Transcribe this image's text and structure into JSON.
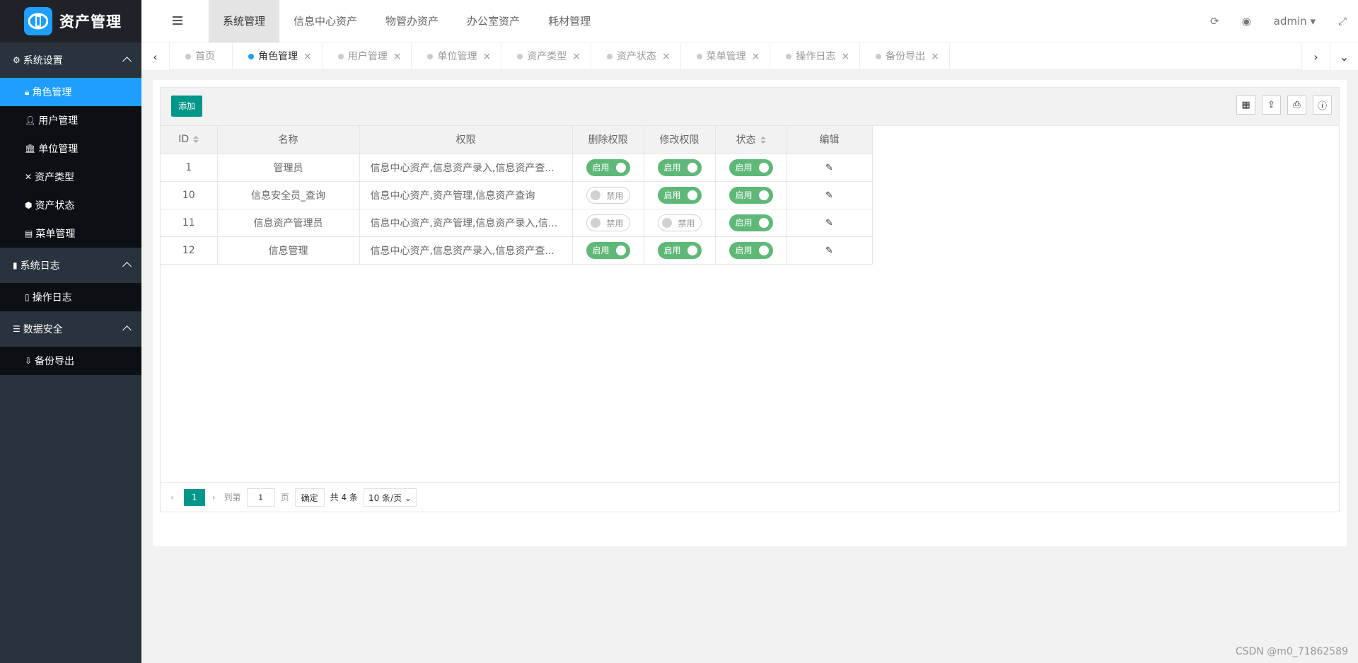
{
  "app": {
    "title": "资产管理"
  },
  "sidebar": [
    {
      "label": "系统设置",
      "icon": "gears-icon",
      "items": [
        {
          "label": "角色管理",
          "icon": "user-lock-icon",
          "active": true
        },
        {
          "label": "用户管理",
          "icon": "user-icon"
        },
        {
          "label": "单位管理",
          "icon": "bank-icon"
        },
        {
          "label": "资产类型",
          "icon": "cross-tools-icon"
        },
        {
          "label": "资产状态",
          "icon": "cube-icon"
        },
        {
          "label": "菜单管理",
          "icon": "menu-card-icon"
        }
      ]
    },
    {
      "label": "系统日志",
      "icon": "file-icon",
      "items": [
        {
          "label": "操作日志",
          "icon": "file-text-icon"
        }
      ]
    },
    {
      "label": "数据安全",
      "icon": "database-icon",
      "items": [
        {
          "label": "备份导出",
          "icon": "download-icon"
        }
      ]
    }
  ],
  "topnav": [
    "系统管理",
    "信息中心资产",
    "物管办资产",
    "办公室资产",
    "耗材管理"
  ],
  "user": "admin",
  "tabs": [
    {
      "label": "首页",
      "closable": false
    },
    {
      "label": "角色管理",
      "active": true
    },
    {
      "label": "用户管理"
    },
    {
      "label": "单位管理"
    },
    {
      "label": "资产类型"
    },
    {
      "label": "资产状态"
    },
    {
      "label": "菜单管理"
    },
    {
      "label": "操作日志"
    },
    {
      "label": "备份导出"
    }
  ],
  "toolbar": {
    "add_label": "添加"
  },
  "table": {
    "headers": [
      "ID",
      "名称",
      "权限",
      "删除权限",
      "修改权限",
      "状态",
      "编辑"
    ],
    "rows": [
      {
        "id": "1",
        "name": "管理员",
        "perm": "信息中心资产,信息资产录入,信息资产查...",
        "del": "启用",
        "mod": "启用",
        "status": "启用"
      },
      {
        "id": "10",
        "name": "信息安全员_查询",
        "perm": "信息中心资产,资产管理,信息资产查询",
        "del": "禁用",
        "mod": "启用",
        "status": "启用"
      },
      {
        "id": "11",
        "name": "信息资产管理员",
        "perm": "信息中心资产,资产管理,信息资产录入,信...",
        "del": "禁用",
        "mod": "禁用",
        "status": "启用"
      },
      {
        "id": "12",
        "name": "信息管理",
        "perm": "信息中心资产,信息资产录入,信息资产查...",
        "del": "启用",
        "mod": "启用",
        "status": "启用"
      }
    ]
  },
  "pager": {
    "page": "1",
    "goto_label": "到第",
    "page_input": "1",
    "page_unit": "页",
    "confirm": "确定",
    "total": "共 4 条",
    "size": "10 条/页"
  },
  "watermark": "CSDN @m0_71862589",
  "colors": {
    "accent": "#1e9fff",
    "primary": "#009688",
    "switch_on": "#5fb878",
    "sidebar": "#28333e"
  }
}
